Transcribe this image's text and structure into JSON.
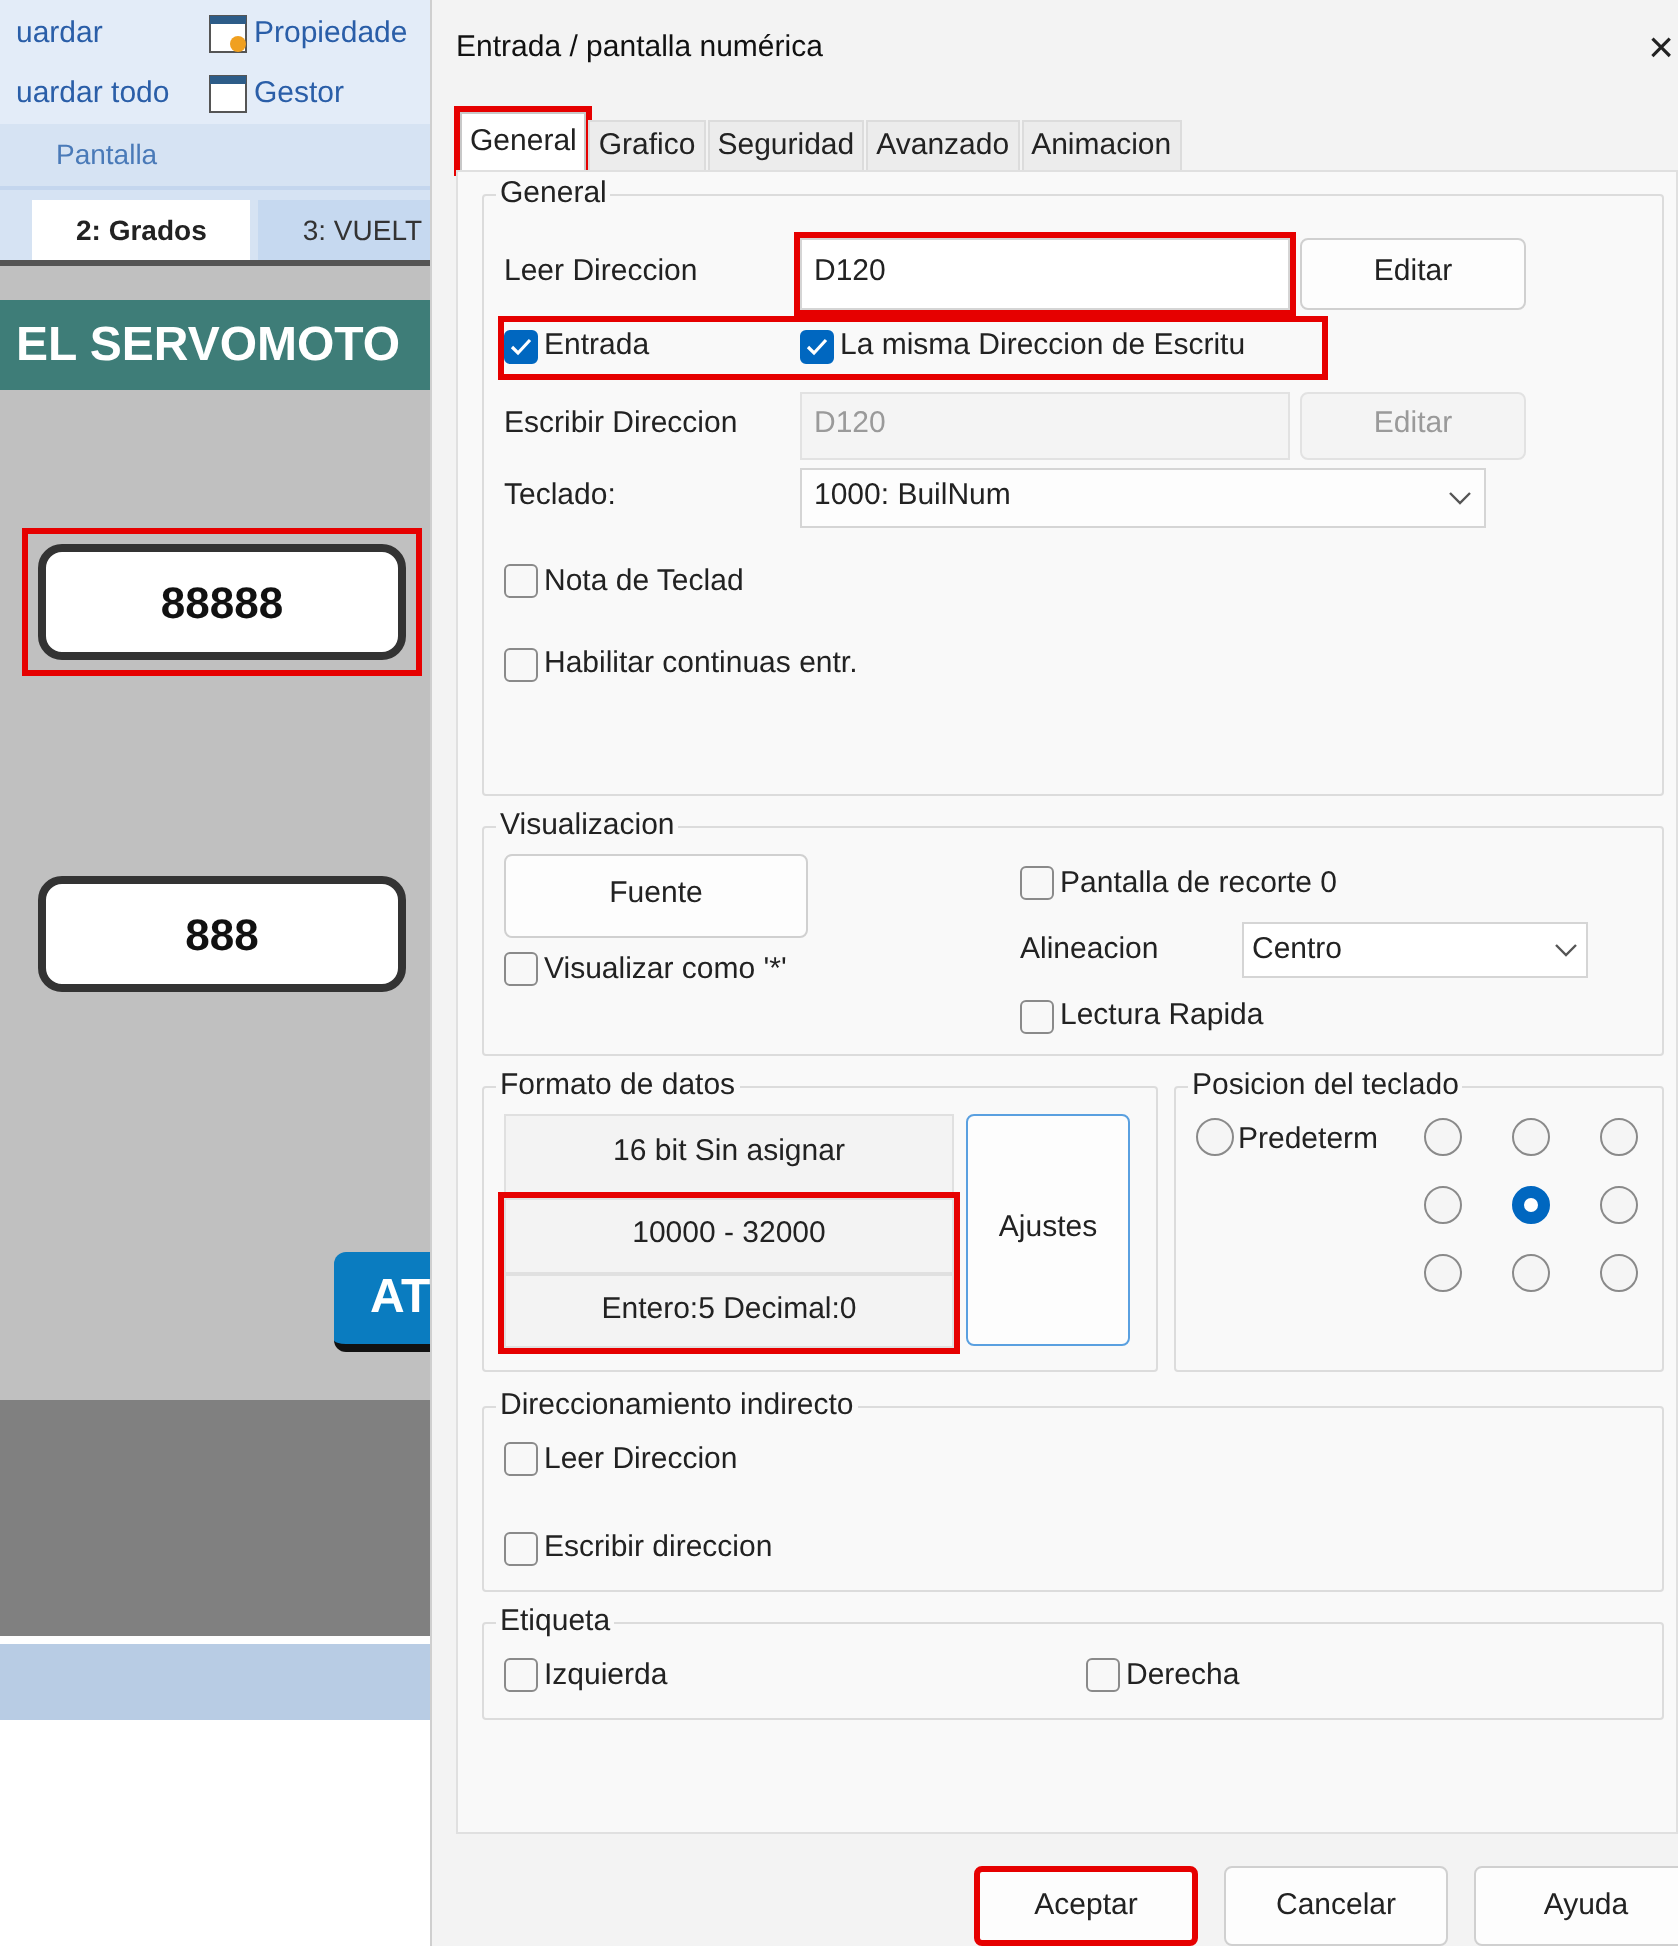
{
  "editor": {
    "ribbon": {
      "columns": [
        {
          "items": [
            {
              "label": "uardar",
              "icon": false
            },
            {
              "label": "uardar todo",
              "icon": false
            }
          ]
        },
        {
          "items": [
            {
              "label": "Propiedade",
              "icon": true
            },
            {
              "label": "Gestor",
              "icon": true
            }
          ]
        }
      ],
      "group_label": "Pantalla"
    },
    "tabs": [
      {
        "label": "2: Grados",
        "selected": true
      },
      {
        "label": "3: VUELT",
        "selected": false
      }
    ],
    "canvas": {
      "header": "EL SERVOMOTO",
      "displays": [
        {
          "value": "88888",
          "highlighted": true
        },
        {
          "value": "888",
          "highlighted": false
        }
      ],
      "button": "AT"
    }
  },
  "dialog": {
    "title": "Entrada / pantalla numérica",
    "close": "×",
    "tabs": [
      {
        "label": "General",
        "selected": true,
        "highlighted": true
      },
      {
        "label": "Grafico",
        "selected": false,
        "highlighted": false
      },
      {
        "label": "Seguridad",
        "selected": false,
        "highlighted": false
      },
      {
        "label": "Avanzado",
        "selected": false,
        "highlighted": false
      },
      {
        "label": "Animacion",
        "selected": false,
        "highlighted": false
      }
    ],
    "general": {
      "title": "General",
      "read_address": {
        "label": "Leer Direccion",
        "value": "D120",
        "button": "Editar",
        "highlighted": true
      },
      "options": {
        "highlighted": true,
        "items": [
          {
            "label": "Entrada",
            "checked": true
          },
          {
            "label": "La misma Direccion de Escritu",
            "checked": true
          }
        ]
      },
      "write_address": {
        "label": "Escribir Direccion",
        "value": "D120",
        "button": "Editar",
        "disabled": true
      },
      "keyboard": {
        "label": "Teclado:",
        "value": "1000: BuilNum"
      },
      "checks": [
        {
          "label": "Nota de Teclad",
          "checked": false
        },
        {
          "label": "Habilitar continuas entr.",
          "checked": false
        }
      ]
    },
    "display": {
      "title": "Visualizacion",
      "font_button": "Fuente",
      "mask": {
        "label": "Visualizar como '*'",
        "checked": false
      },
      "clip": {
        "label": "Pantalla de recorte 0",
        "checked": false
      },
      "alignment": {
        "label": "Alineacion",
        "value": "Centro"
      },
      "fast_read": {
        "label": "Lectura Rapida",
        "checked": false
      }
    },
    "data_format": {
      "title": "Formato de datos",
      "type": "16 bit Sin asignar",
      "range": "10000 - 32000",
      "digits": "Entero:5 Decimal:0",
      "highlighted": true,
      "settings_button": "Ajustes"
    },
    "keypad_position": {
      "title": "Posicion del teclado",
      "default": {
        "label": "Predeterm",
        "selected": false
      },
      "positions": [
        {
          "selected": false
        },
        {
          "selected": false
        },
        {
          "selected": false
        },
        {
          "selected": false
        },
        {
          "selected": true
        },
        {
          "selected": false
        },
        {
          "selected": false
        },
        {
          "selected": false
        },
        {
          "selected": false
        }
      ]
    },
    "indirect": {
      "title": "Direccionamiento indirecto",
      "checks": [
        {
          "label": "Leer Direccion",
          "checked": false
        },
        {
          "label": "Escribir direccion",
          "checked": false
        }
      ]
    },
    "label": {
      "title": "Etiqueta",
      "checks": [
        {
          "label": "Izquierda",
          "checked": false
        },
        {
          "label": "Derecha",
          "checked": false
        }
      ]
    },
    "buttons": [
      {
        "label": "Aceptar",
        "highlighted": true
      },
      {
        "label": "Cancelar",
        "highlighted": false
      },
      {
        "label": "Ayuda",
        "highlighted": false
      }
    ]
  }
}
